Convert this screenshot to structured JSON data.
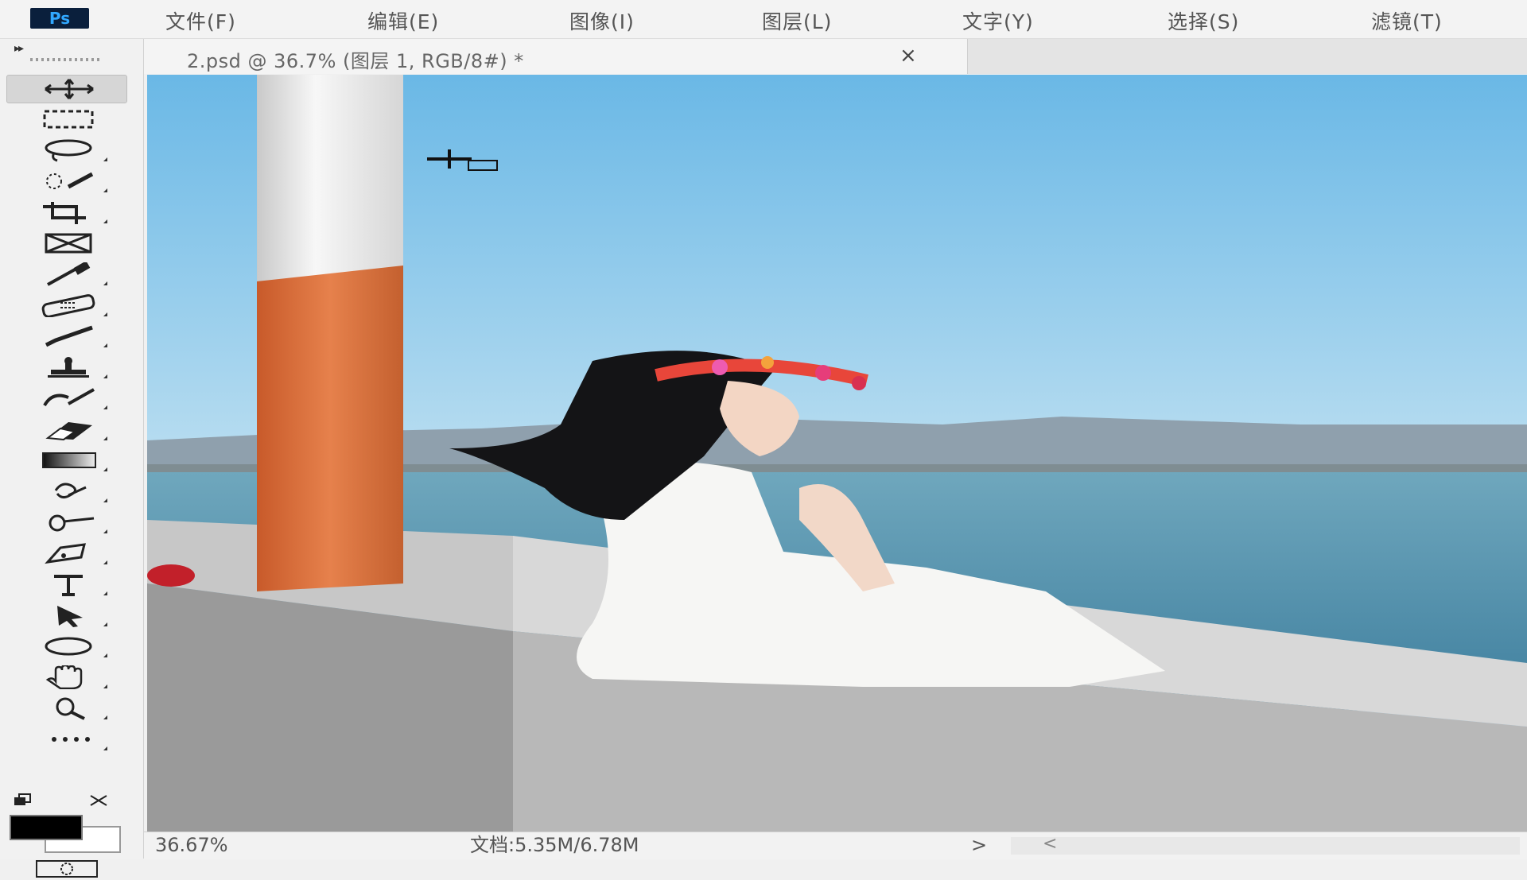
{
  "app": {
    "logo_text": "Ps",
    "menu": [
      "文件(F)",
      "编辑(E)",
      "图像(I)",
      "图层(L)",
      "文字(Y)",
      "选择(S)",
      "滤镜(T)"
    ]
  },
  "panel": {
    "collapse_glyph": "▸▸"
  },
  "tools": [
    {
      "name": "move-tool",
      "icon": "move-icon",
      "active": true
    },
    {
      "name": "marquee-tool",
      "icon": "rectangular-marquee-icon"
    },
    {
      "name": "lasso-tool",
      "icon": "lasso-icon"
    },
    {
      "name": "quick-selection-tool",
      "icon": "quick-selection-icon"
    },
    {
      "name": "crop-tool",
      "icon": "crop-icon"
    },
    {
      "name": "frame-tool",
      "icon": "frame-icon"
    },
    {
      "name": "eyedropper-tool",
      "icon": "eyedropper-icon"
    },
    {
      "name": "healing-brush-tool",
      "icon": "bandage-icon"
    },
    {
      "name": "brush-tool",
      "icon": "brush-icon"
    },
    {
      "name": "clone-stamp-tool",
      "icon": "stamp-icon"
    },
    {
      "name": "history-brush-tool",
      "icon": "history-brush-icon"
    },
    {
      "name": "eraser-tool",
      "icon": "eraser-icon"
    },
    {
      "name": "gradient-tool",
      "icon": "gradient-icon"
    },
    {
      "name": "blur-tool",
      "icon": "blur-icon"
    },
    {
      "name": "dodge-tool",
      "icon": "dodge-icon"
    },
    {
      "name": "pen-tool",
      "icon": "pen-icon"
    },
    {
      "name": "type-tool",
      "icon": "type-icon",
      "label": "T"
    },
    {
      "name": "path-selection-tool",
      "icon": "arrow-icon"
    },
    {
      "name": "ellipse-tool",
      "icon": "ellipse-icon"
    },
    {
      "name": "hand-tool",
      "icon": "hand-icon"
    },
    {
      "name": "zoom-tool",
      "icon": "zoom-icon"
    },
    {
      "name": "more-tools",
      "icon": "more-icon",
      "label": "•••"
    }
  ],
  "colors": {
    "foreground": "#000000",
    "background": "#ffffff",
    "swap_glyph": "⇄"
  },
  "document": {
    "tab_title": "2.psd @ 36.7% (图层 1, RGB/8#) *",
    "close_glyph": "×"
  },
  "status": {
    "zoom": "36.67%",
    "doc_info": "文档:5.35M/6.78M",
    "arrow": ">",
    "scroll_left": "<"
  }
}
